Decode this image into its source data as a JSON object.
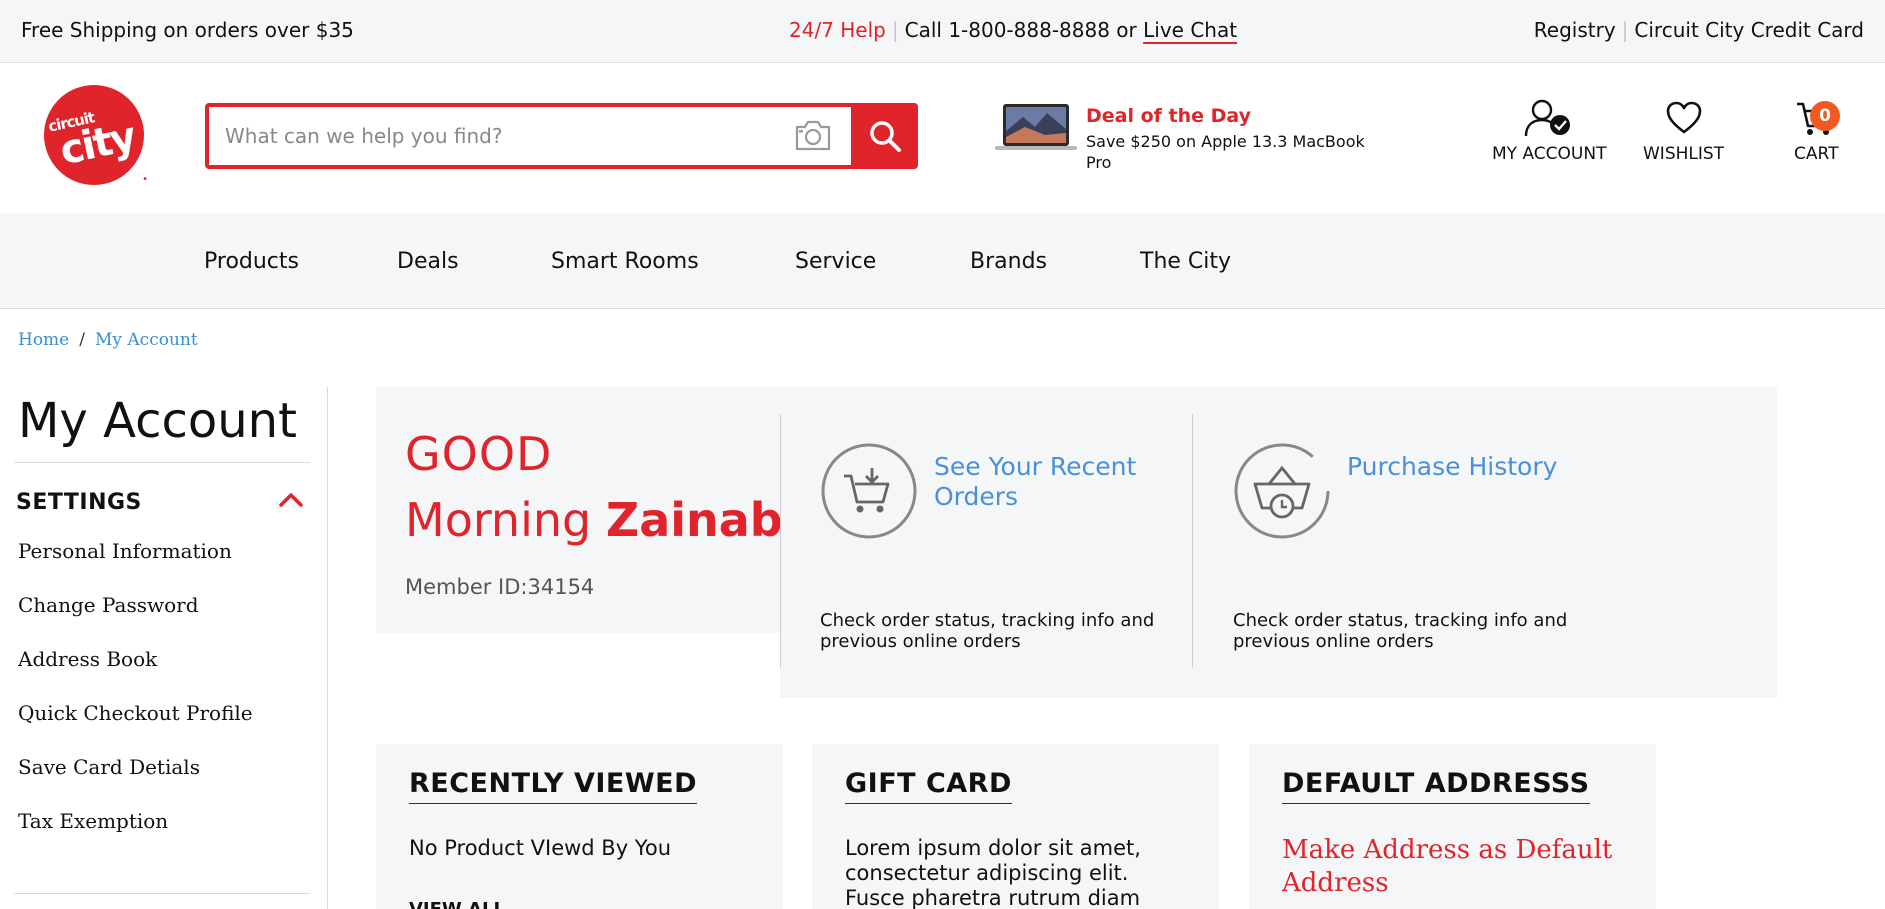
{
  "topbar": {
    "shipping": "Free Shipping on orders over $35",
    "help": "24/7 Help",
    "call": "Call 1-800-888-8888 or",
    "live_chat": "Live Chat",
    "registry": "Registry",
    "credit_card": "Circuit City Credit Card"
  },
  "search": {
    "placeholder": "What can we help you find?"
  },
  "deal": {
    "title": "Deal of the Day",
    "description": "Save $250 on Apple 13.3 MacBook Pro"
  },
  "header_icons": {
    "account": "MY ACCOUNT",
    "wishlist": "WISHLIST",
    "cart": "CART",
    "cart_count": "0"
  },
  "nav": {
    "items": [
      "Products",
      "Deals",
      "Smart Rooms",
      "Service",
      "Brands",
      "The City"
    ]
  },
  "breadcrumb": {
    "home": "Home",
    "separator": "/",
    "current": "My Account"
  },
  "sidebar": {
    "title": "My Account",
    "section": "SETTINGS",
    "items": [
      "Personal Information",
      "Change Password",
      "Address Book",
      "Quick Checkout Profile",
      "Save Card Detials",
      "Tax Exemption"
    ]
  },
  "greeting": {
    "line1": "GOOD",
    "line2_prefix": "Morning",
    "name": "Zainab",
    "member_id": "Member ID:34154"
  },
  "orders": {
    "recent_link": "See Your Recent Orders",
    "recent_desc": "Check order status, tracking info and previous online orders",
    "history_link": "Purchase History",
    "history_desc": "Check order status, tracking info and previous online orders"
  },
  "cards": {
    "recent_title": "RECENTLY VIEWED",
    "recent_body": "No Product VIewd By You",
    "recent_viewall": "VIEW ALL",
    "gift_title": "GIFT CARD",
    "gift_body": "Lorem ipsum dolor sit amet, consectetur adipiscing elit. Fusce pharetra rutrum diam",
    "address_title": "DEFAULT ADDRESSS",
    "address_body": "Make Address as Default Address"
  },
  "colors": {
    "brand_red": "#e0242b",
    "link_blue": "#4a90d9",
    "badge_orange": "#f05a22",
    "panel_gray": "#f5f6f8"
  }
}
